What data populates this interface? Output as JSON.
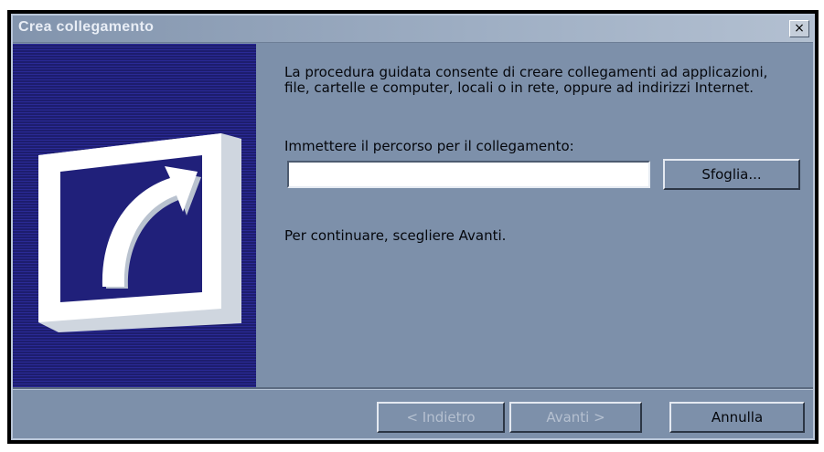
{
  "window": {
    "title": "Crea collegamento",
    "close_label": "×"
  },
  "banner": {
    "icon": "shortcut-arrow-icon",
    "colors": {
      "background": "#27278a",
      "frame": "#ffffff"
    }
  },
  "main": {
    "intro": "La procedura guidata consente di creare collegamenti ad applicazioni, file, cartelle e computer, locali o in rete, oppure ad indirizzi Internet.",
    "path_label": "Immettere il percorso per il collegamento:",
    "path_value": "",
    "browse_label": "Sfoglia...",
    "continue_text": "Per continuare, scegliere Avanti."
  },
  "footer": {
    "back_label": "< Indietro",
    "next_label": "Avanti >",
    "cancel_label": "Annulla"
  }
}
